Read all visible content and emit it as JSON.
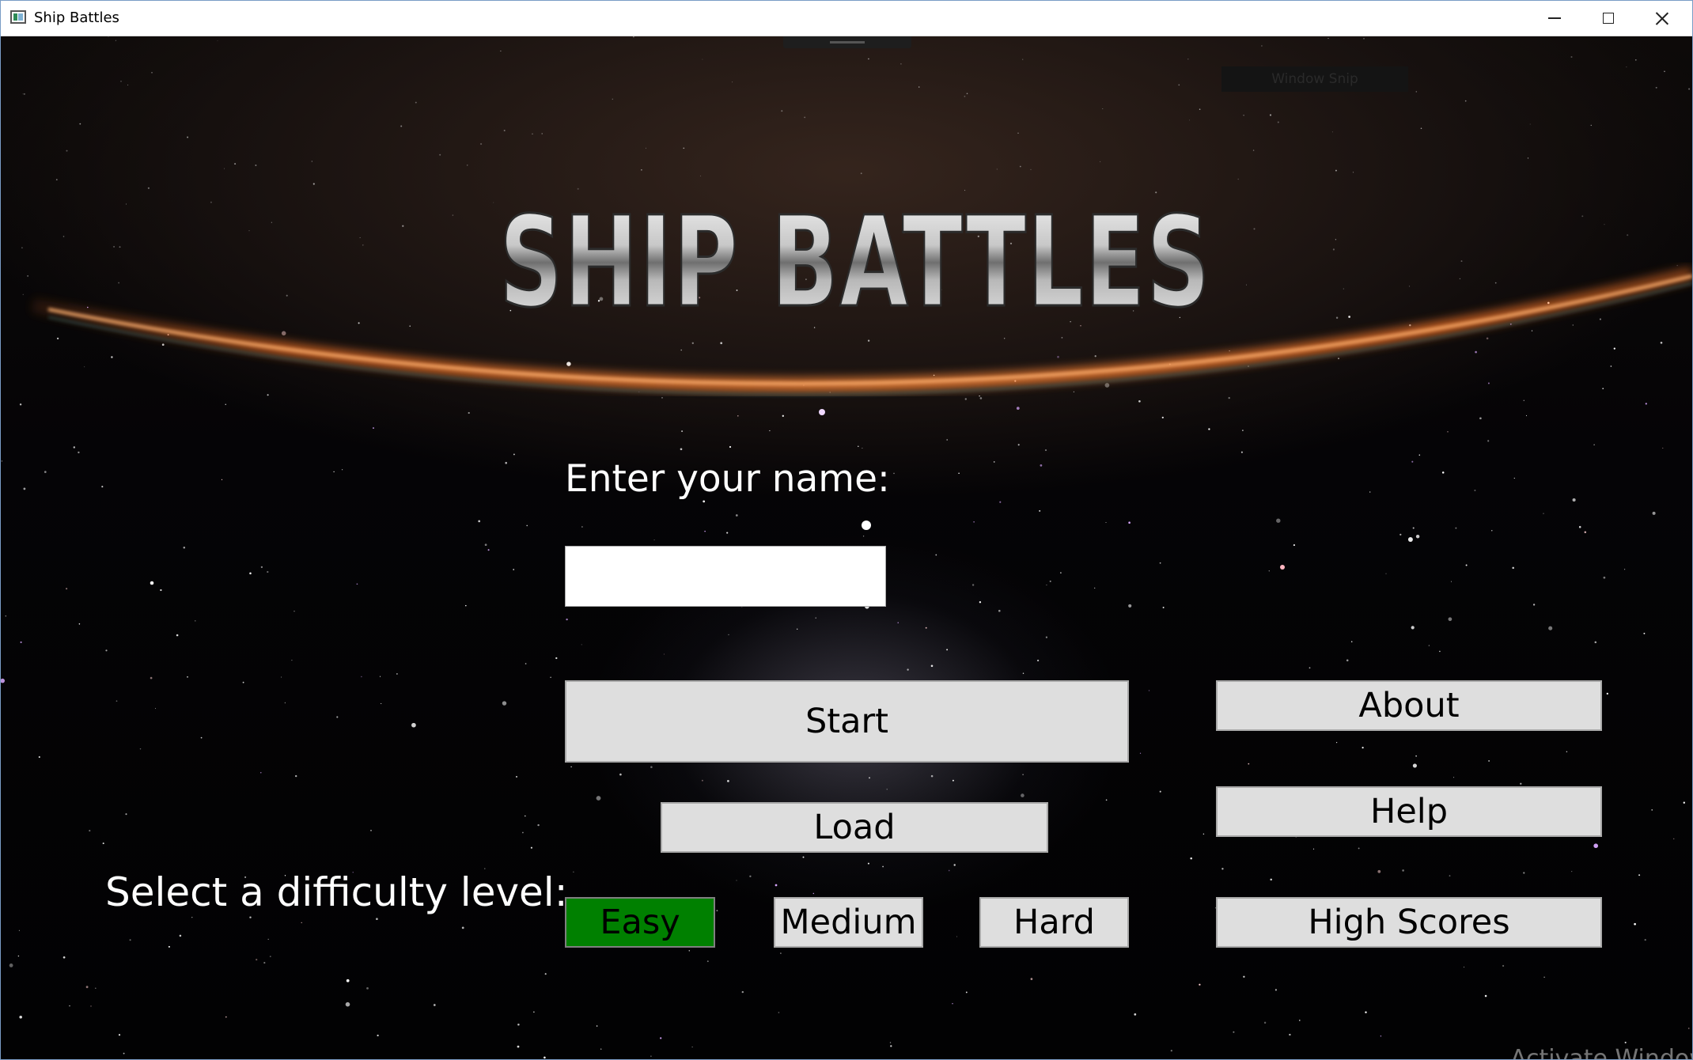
{
  "window": {
    "title": "Ship Battles"
  },
  "overlay": {
    "snip_label": "Window Snip"
  },
  "game": {
    "logo_text": "SHIP BATTLES",
    "name_prompt": "Enter your name:",
    "name_value": "",
    "difficulty_prompt": "Select a difficulty level:",
    "selected_difficulty": "Easy",
    "selected_color": "#008000"
  },
  "buttons": {
    "start": "Start",
    "load": "Load",
    "about": "About",
    "help": "Help",
    "high_scores": "High Scores",
    "easy": "Easy",
    "medium": "Medium",
    "hard": "Hard"
  },
  "watermark": {
    "text": "Activate Windows"
  },
  "icons": {
    "app": "app-window-icon",
    "minimize": "minimize-icon",
    "maximize": "maximize-icon",
    "close": "close-icon"
  }
}
